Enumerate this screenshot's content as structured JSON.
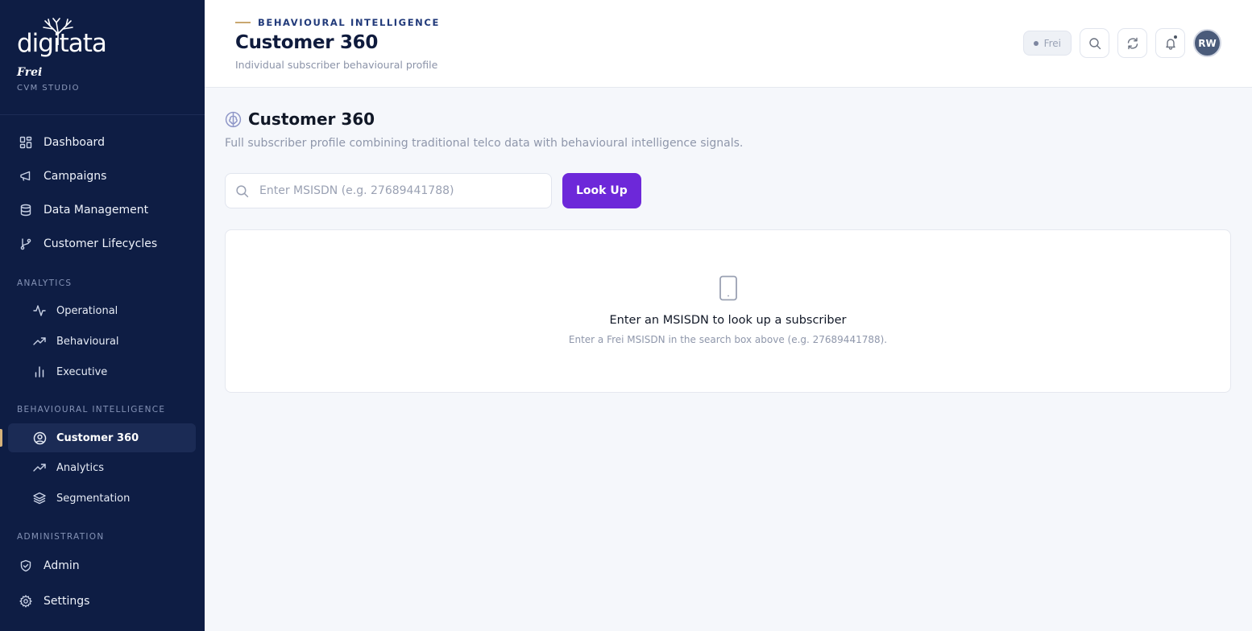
{
  "brand": {
    "logo_text": "digitata",
    "tenant": "Frei",
    "product": "CVM STUDIO"
  },
  "sidebar": {
    "main_items": [
      {
        "label": "Dashboard",
        "icon": "grid-icon"
      },
      {
        "label": "Campaigns",
        "icon": "megaphone-icon"
      },
      {
        "label": "Data Management",
        "icon": "database-icon"
      },
      {
        "label": "Customer Lifecycles",
        "icon": "git-branch-icon"
      }
    ],
    "analytics_label": "ANALYTICS",
    "analytics_items": [
      {
        "label": "Operational",
        "icon": "activity-icon"
      },
      {
        "label": "Behavioural",
        "icon": "trending-up-icon"
      },
      {
        "label": "Executive",
        "icon": "bar-chart-icon"
      }
    ],
    "bi_label": "BEHAVIOURAL INTELLIGENCE",
    "bi_items": [
      {
        "label": "Customer 360",
        "icon": "user-circle-icon",
        "active": true
      },
      {
        "label": "Analytics",
        "icon": "trending-up-icon"
      },
      {
        "label": "Segmentation",
        "icon": "layers-icon"
      }
    ],
    "admin_label": "ADMINISTRATION",
    "admin_items": [
      {
        "label": "Admin",
        "icon": "shield-icon"
      },
      {
        "label": "Settings",
        "icon": "gear-icon"
      }
    ]
  },
  "header": {
    "eyebrow": "BEHAVIOURAL INTELLIGENCE",
    "title": "Customer 360",
    "subtitle": "Individual subscriber behavioural profile",
    "tenant_pill": "Frei",
    "avatar_initials": "RW"
  },
  "main": {
    "title": "Customer 360",
    "description": "Full subscriber profile combining traditional telco data with behavioural intelligence signals.",
    "search": {
      "placeholder": "Enter MSISDN (e.g. 27689441788)",
      "value": "",
      "button_label": "Look Up"
    },
    "empty_state": {
      "title": "Enter an MSISDN to look up a subscriber",
      "subtitle": "Enter a Frei MSISDN in the search box above (e.g. 27689441788)."
    }
  },
  "colors": {
    "sidebar_bg": "#0e1d44",
    "accent": "#6d28d9",
    "active_marker": "#d6b27a"
  }
}
